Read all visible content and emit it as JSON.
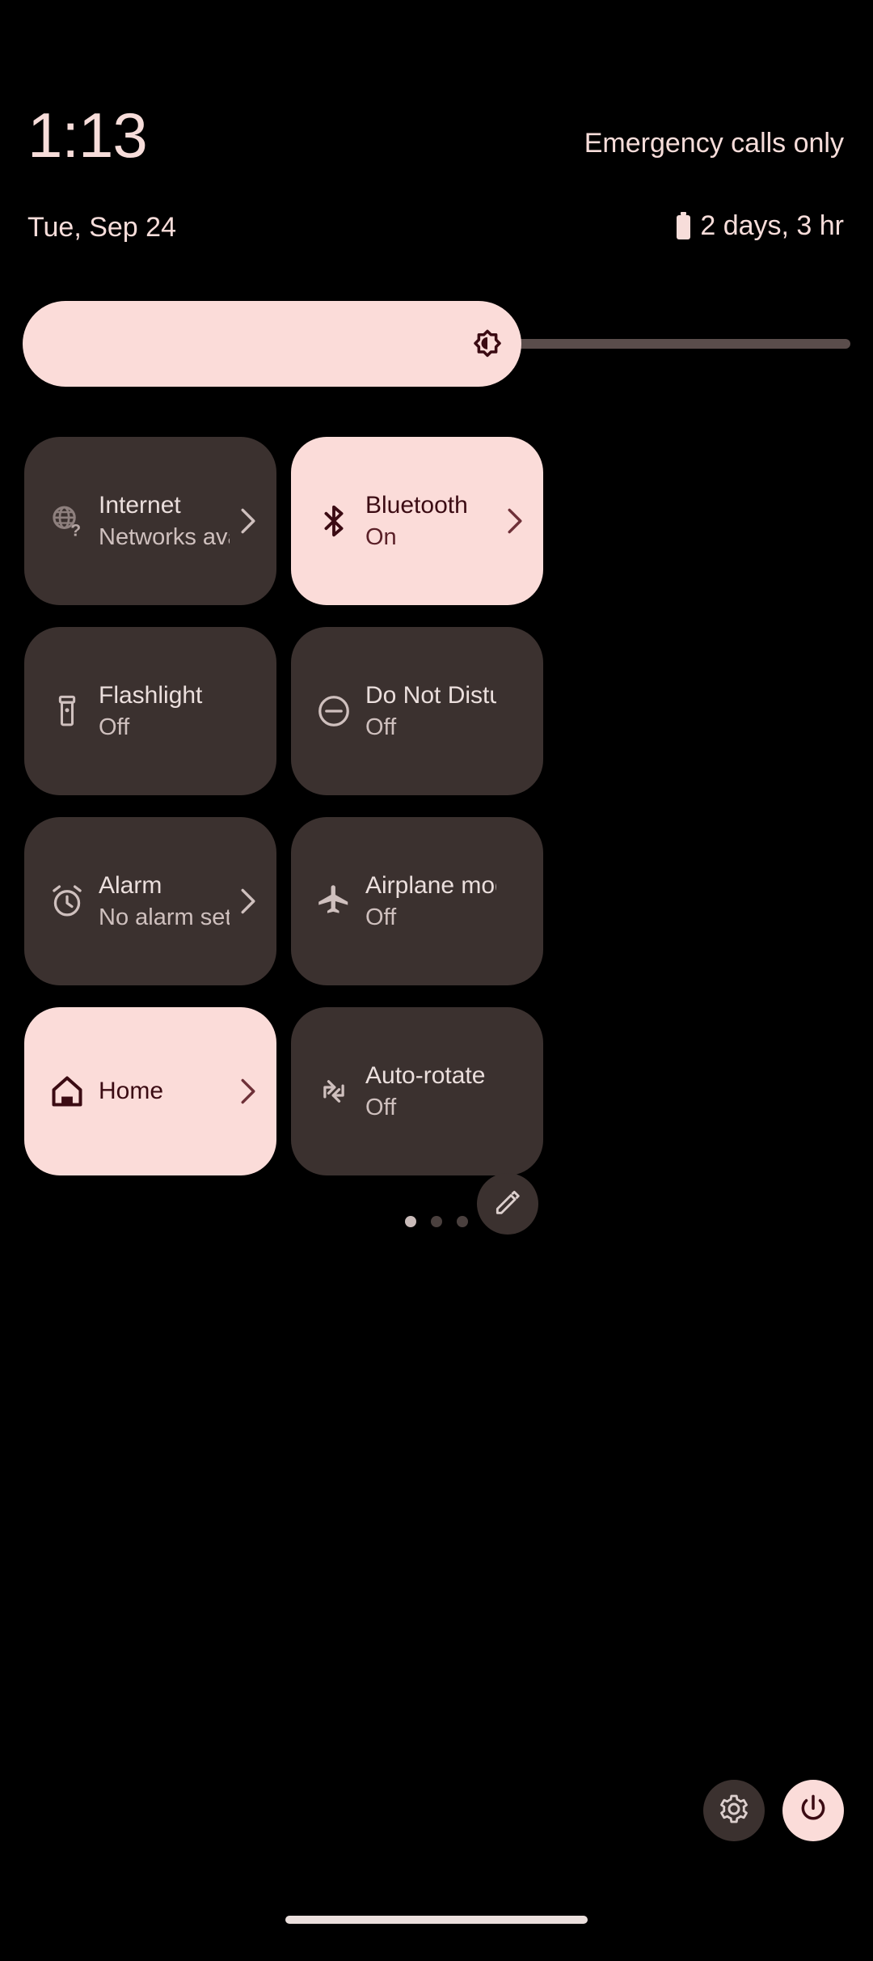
{
  "status": {
    "time": "1:13",
    "carrier": "Emergency calls only",
    "date": "Tue, Sep 24",
    "battery_estimate": "2 days, 3 hr",
    "battery_icon": "battery-icon"
  },
  "brightness": {
    "name": "brightness-slider",
    "icon": "brightness-icon",
    "value_percent": 60
  },
  "tiles": [
    {
      "name": "internet",
      "icon": "globe-question-icon",
      "label": "Internet",
      "sub": "Networks avai..",
      "active": false,
      "chevron": true
    },
    {
      "name": "bluetooth",
      "icon": "bluetooth-icon",
      "label": "Bluetooth",
      "sub": "On",
      "active": true,
      "chevron": true
    },
    {
      "name": "flashlight",
      "icon": "flashlight-icon",
      "label": "Flashlight",
      "sub": "Off",
      "active": false,
      "chevron": false
    },
    {
      "name": "do-not-disturb",
      "icon": "do-not-disturb-icon",
      "label": "Do Not Disturb",
      "sub": "Off",
      "active": false,
      "chevron": false
    },
    {
      "name": "alarm",
      "icon": "alarm-clock-icon",
      "label": "Alarm",
      "sub": "No alarm set",
      "active": false,
      "chevron": true
    },
    {
      "name": "airplane-mode",
      "icon": "airplane-icon",
      "label": "Airplane mode",
      "sub": "Off",
      "active": false,
      "chevron": false
    },
    {
      "name": "home",
      "icon": "home-icon",
      "label": "Home",
      "sub": "",
      "active": true,
      "chevron": true
    },
    {
      "name": "auto-rotate",
      "icon": "auto-rotate-icon",
      "label": "Auto-rotate",
      "sub": "Off",
      "active": false,
      "chevron": false
    }
  ],
  "pager": {
    "name": "page-indicator",
    "count": 3,
    "current": 1
  },
  "edit_button": {
    "name": "edit-tiles-button",
    "icon": "pencil-icon"
  },
  "footer": {
    "settings": {
      "name": "settings-button",
      "icon": "gear-icon"
    },
    "power": {
      "name": "power-button",
      "icon": "power-icon"
    }
  },
  "nav": {
    "name": "gesture-nav-bar"
  },
  "colors": {
    "background": "#000000",
    "tile_inactive": "#3B312F",
    "tile_active": "#FBDCD9",
    "accent_pink": "#FBDCD9",
    "text_primary": "#EBDFDD",
    "text_secondary": "#CFC0BE",
    "text_on_accent": "#3B0B13",
    "track": "#5A4D4B"
  }
}
